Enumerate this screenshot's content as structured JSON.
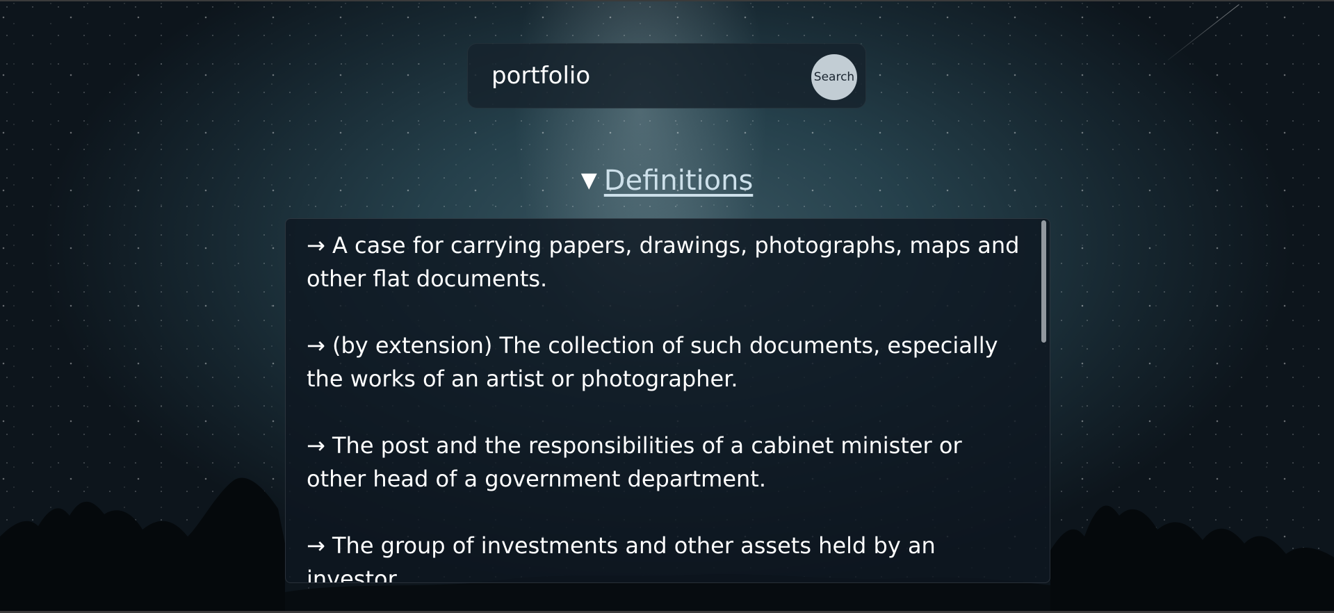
{
  "search": {
    "value": "portfolio",
    "button_label": "Search"
  },
  "definitions": {
    "toggle_glyph": "▼",
    "heading": "Definitions",
    "items": [
      "→ A case for carrying papers, drawings, photographs, maps and other flat documents.",
      "→ (by extension) The collection of such documents, especially the works of an artist or photographer.",
      "→ The post and the responsibilities of a cabinet minister or other head of a government department.",
      "→ The group of investments and other assets held by an investor."
    ]
  },
  "colors": {
    "panel_bg": "#0e1620",
    "search_button_bg": "#c2cdd4",
    "link_color": "#cde0ea",
    "sky_center": "#3a5661",
    "sky_edge": "#0d151c"
  },
  "icons": {
    "toggle": "triangle-down-icon"
  }
}
